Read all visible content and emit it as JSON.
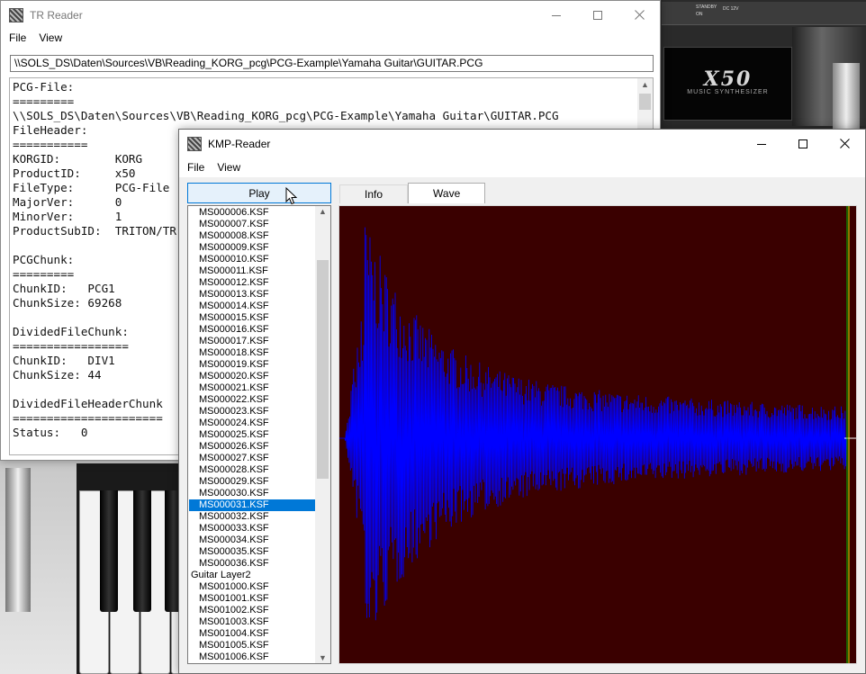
{
  "background": {
    "synth_logo": "X50",
    "synth_subtitle": "MUSIC SYNTHESIZER",
    "panel_labels": [
      "STANDBY",
      "ON",
      "DC 12V"
    ]
  },
  "tr_reader": {
    "title": "TR Reader",
    "menu": [
      "File",
      "View"
    ],
    "path": "\\\\SOLS_DS\\Daten\\Sources\\VB\\Reading_KORG_pcg\\PCG-Example\\Yamaha Guitar\\GUITAR.PCG",
    "text_lines": [
      "PCG-File:",
      "=========",
      "\\\\SOLS_DS\\Daten\\Sources\\VB\\Reading_KORG_pcg\\PCG-Example\\Yamaha Guitar\\GUITAR.PCG",
      "FileHeader:",
      "===========",
      "KORGID:        KORG",
      "ProductID:     x50",
      "FileType:      PCG-File",
      "MajorVer:      0",
      "MinorVer:      1",
      "ProductSubID:  TRITON/TR",
      "",
      "PCGChunk:",
      "=========",
      "ChunkID:   PCG1",
      "ChunkSize: 69268",
      "",
      "DividedFileChunk:",
      "=================",
      "ChunkID:   DIV1",
      "ChunkSize: 44",
      "",
      "DividedFileHeaderChunk",
      "======================",
      "Status:   0"
    ]
  },
  "kmp_reader": {
    "title": "KMP-Reader",
    "menu": [
      "File",
      "View"
    ],
    "play_label": "Play",
    "tabs": [
      {
        "label": "Info",
        "active": false
      },
      {
        "label": "Wave",
        "active": true
      }
    ],
    "selected_item": "MS000031.KSF",
    "list_items": [
      "MS000006.KSF",
      "MS000007.KSF",
      "MS000008.KSF",
      "MS000009.KSF",
      "MS000010.KSF",
      "MS000011.KSF",
      "MS000012.KSF",
      "MS000013.KSF",
      "MS000014.KSF",
      "MS000015.KSF",
      "MS000016.KSF",
      "MS000017.KSF",
      "MS000018.KSF",
      "MS000019.KSF",
      "MS000020.KSF",
      "MS000021.KSF",
      "MS000022.KSF",
      "MS000023.KSF",
      "MS000024.KSF",
      "MS000025.KSF",
      "MS000026.KSF",
      "MS000027.KSF",
      "MS000028.KSF",
      "MS000029.KSF",
      "MS000030.KSF",
      "MS000031.KSF",
      "MS000032.KSF",
      "MS000033.KSF",
      "MS000034.KSF",
      "MS000035.KSF",
      "MS000036.KSF",
      "Guitar Layer2",
      "MS001000.KSF",
      "MS001001.KSF",
      "MS001002.KSF",
      "MS001003.KSF",
      "MS001004.KSF",
      "MS001005.KSF",
      "MS001006.KSF"
    ],
    "group_items": [
      "Guitar Layer2"
    ],
    "colors": {
      "wave_background": "#3a0000",
      "wave_color": "#0000ff",
      "marker_yellow": "#e6e600",
      "marker_green": "#00c000",
      "selection": "#0078d7"
    }
  }
}
